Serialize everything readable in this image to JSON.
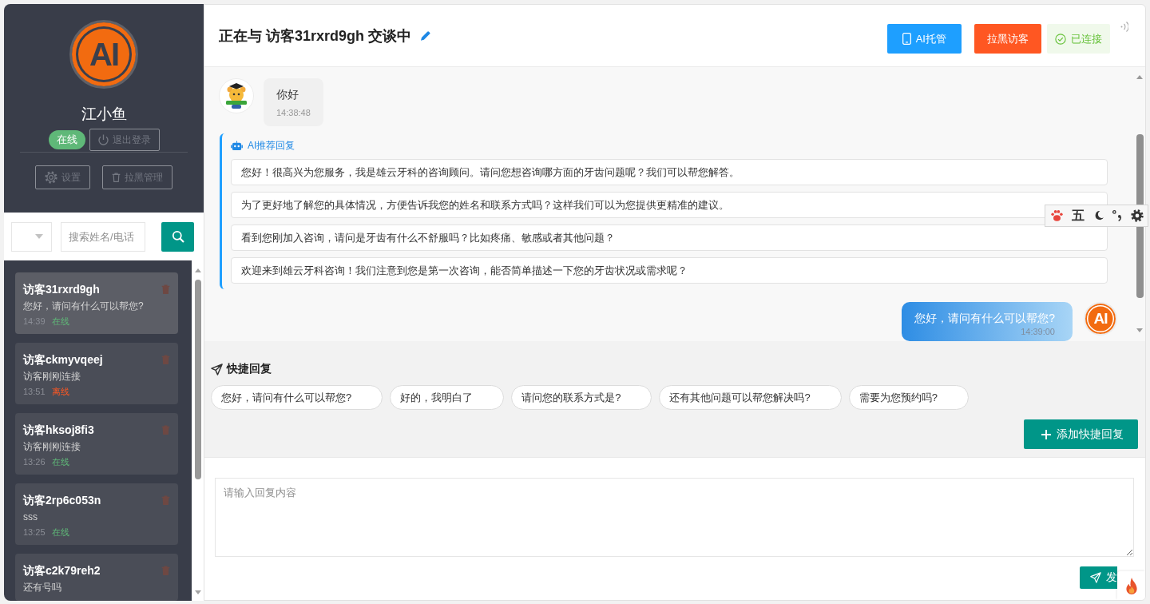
{
  "agent": {
    "avatar_text": "AI",
    "name": "江小鱼",
    "status": "在线",
    "online": true,
    "logout": "退出登录",
    "actions": [
      {
        "kind": "settings",
        "label": "设置"
      },
      {
        "kind": "blacklist",
        "label": "拉黑管理"
      }
    ]
  },
  "filter": {
    "search_placeholder": "搜索姓名/电话"
  },
  "visitors": [
    {
      "name": "访客31rxrd9gh",
      "last_message": "您好，请问有什么可以帮您?",
      "time": "14:39",
      "status": "在线",
      "online": true,
      "selected": true
    },
    {
      "name": "访客ckmyvqeej",
      "last_message": "访客刚刚连接",
      "time": "13:51",
      "status": "离线",
      "online": false,
      "selected": false
    },
    {
      "name": "访客hksoj8fi3",
      "last_message": "访客刚刚连接",
      "time": "13:26",
      "status": "在线",
      "online": true,
      "selected": false
    },
    {
      "name": "访客2rp6c053n",
      "last_message": "sss",
      "time": "13:25",
      "status": "在线",
      "online": true,
      "selected": false
    },
    {
      "name": "访客c2k79reh2",
      "last_message": "还有号吗",
      "selected": false
    }
  ],
  "chat_header": {
    "title": "正在与 访客31rxrd9gh 交谈中",
    "buttons": [
      {
        "kind": "ai",
        "label": "AI托管"
      },
      {
        "kind": "block",
        "label": "拉黑访客"
      }
    ],
    "connection": {
      "label": "已连接",
      "connected": true
    }
  },
  "messages": [
    {
      "kind": "visitor",
      "text": "你好",
      "time": "14:38:48"
    },
    {
      "kind": "ai_suggestions",
      "title": "AI推荐回复",
      "items": [
        "您好！很高兴为您服务，我是雄云牙科的咨询顾问。请问您想咨询哪方面的牙齿问题呢？我们可以帮您解答。",
        "为了更好地了解您的具体情况，方便告诉我您的姓名和联系方式吗？这样我们可以为您提供更精准的建议。",
        "看到您刚加入咨询，请问是牙齿有什么不舒服吗？比如疼痛、敏感或者其他问题？",
        "欢迎来到雄云牙科咨询！我们注意到您是第一次咨询，能否简单描述一下您的牙齿状况或需求呢？"
      ]
    },
    {
      "kind": "agent",
      "text": "您好，请问有什么可以帮您?",
      "time": "14:39:00",
      "avatar_text": "AI"
    }
  ],
  "quick_replies": {
    "title": "快捷回复",
    "items": [
      "您好，请问有什么可以帮您?",
      "好的，我明白了",
      "请问您的联系方式是?",
      "还有其他问题可以帮您解决吗?",
      "需要为您预约吗?"
    ],
    "add_button": "添加快捷回复"
  },
  "composer": {
    "placeholder": "请输入回复内容",
    "send_button": "发"
  },
  "ime_toolbar": {
    "mode": "五"
  }
}
